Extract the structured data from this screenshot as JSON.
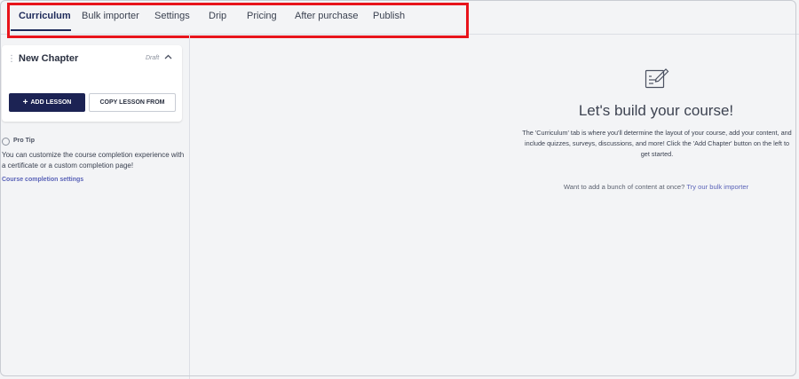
{
  "nav": {
    "tabs": [
      {
        "label": "Curriculum",
        "active": true
      },
      {
        "label": "Bulk importer"
      },
      {
        "label": "Settings"
      },
      {
        "label": "Drip"
      },
      {
        "label": "Pricing"
      },
      {
        "label": "After purchase"
      },
      {
        "label": "Publish"
      }
    ]
  },
  "sidebar": {
    "chapter": {
      "title": "New Chapter",
      "status": "Draft",
      "add_lesson_label": "ADD LESSON",
      "copy_lesson_label": "COPY LESSON FROM"
    },
    "pro_tip": {
      "label": "Pro Tip",
      "text": "You can customize the course completion experience with a certificate or a custom completion page!",
      "link": "Course completion settings"
    }
  },
  "main": {
    "heading": "Let's build your course!",
    "description": "The 'Curriculum' tab is where you'll determine the layout of your course, add your content, and include quizzes, surveys, discussions, and more! Click the 'Add Chapter' button on the left to get started.",
    "bulk_prompt": "Want to add a bunch of content at once?",
    "bulk_link": "Try our bulk importer"
  },
  "colors": {
    "accent": "#1c2354",
    "link": "#5a63b8",
    "highlight": "#e8141b",
    "background": "#f3f4f6"
  }
}
